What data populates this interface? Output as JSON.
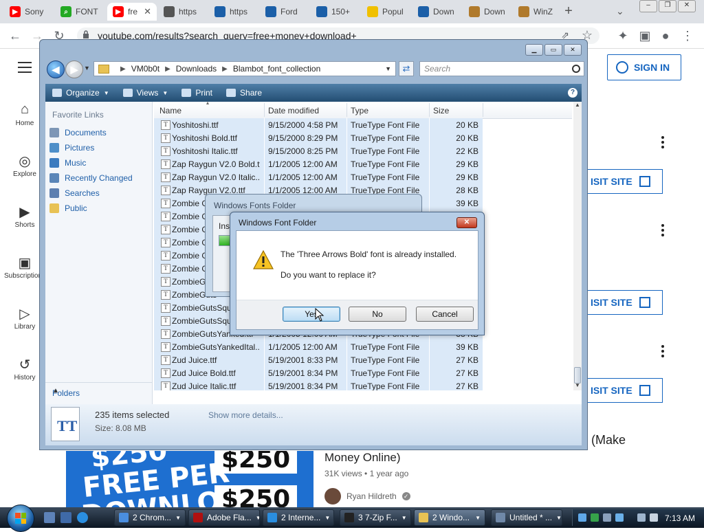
{
  "chrome": {
    "tabs": [
      {
        "label": "Sony",
        "icon": "youtube-icon",
        "color": "#ff0000"
      },
      {
        "label": "FONT",
        "icon": "search-icon",
        "color": "#23a923"
      },
      {
        "label": "fre",
        "icon": "youtube-icon",
        "color": "#ff0000",
        "active": true
      },
      {
        "label": "https",
        "icon": "globe-icon",
        "color": "#555555"
      },
      {
        "label": "https",
        "icon": "zip-icon",
        "color": "#1b5fa8"
      },
      {
        "label": "Ford",
        "icon": "zip-icon",
        "color": "#1b5fa8"
      },
      {
        "label": "150+",
        "icon": "zip-icon",
        "color": "#1b5fa8"
      },
      {
        "label": "Popul",
        "icon": "face-icon",
        "color": "#f0c000"
      },
      {
        "label": "Down",
        "icon": "zip-icon",
        "color": "#1b5fa8"
      },
      {
        "label": "Down",
        "icon": "winzip-icon",
        "color": "#b07a2c"
      },
      {
        "label": "WinZ",
        "icon": "winzip-icon",
        "color": "#b07a2c"
      }
    ],
    "tab_close": "✕",
    "new_tab": "+",
    "url": "youtube.com/results?search_query=free+money+download+"
  },
  "youtube": {
    "sign_in": "SIGN IN",
    "nav": [
      "Home",
      "Explore",
      "Shorts",
      "Subscriptions",
      "Library",
      "History"
    ],
    "visit_site": "ISIT SITE",
    "make_fragment": "(Make",
    "video_title": "Money Online)",
    "views": "31K views",
    "age": "1 year ago",
    "channel": "Ryan Hildreth",
    "thumb": {
      "line1": "$250",
      "line2": "FREE PER",
      "line3": "DOWNLOAD",
      "price1": "$250",
      "price2": "$250"
    }
  },
  "explorer": {
    "path": [
      "VM0b0t",
      "Downloads",
      "Blambot_font_collection"
    ],
    "search_placeholder": "Search",
    "commands": [
      "Organize",
      "Views",
      "Print",
      "Share"
    ],
    "favorite_links_header": "Favorite Links",
    "favorites": [
      "Documents",
      "Pictures",
      "Music",
      "Recently Changed",
      "Searches",
      "Public"
    ],
    "folders_label": "Folders",
    "columns": [
      "Name",
      "Date modified",
      "Type",
      "Size"
    ],
    "files": [
      {
        "name": "Yoshitoshi.ttf",
        "date": "9/15/2000 4:58 PM",
        "type": "TrueType Font File",
        "size": "20 KB"
      },
      {
        "name": "Yoshitoshi Bold.ttf",
        "date": "9/15/2000 8:29 PM",
        "type": "TrueType Font File",
        "size": "20 KB"
      },
      {
        "name": "Yoshitoshi Italic.ttf",
        "date": "9/15/2000 8:25 PM",
        "type": "TrueType Font File",
        "size": "22 KB"
      },
      {
        "name": "Zap Raygun V2.0 Bold.ttf",
        "date": "1/1/2005 12:00 AM",
        "type": "TrueType Font File",
        "size": "29 KB"
      },
      {
        "name": "Zap Raygun V2.0 Italic....",
        "date": "1/1/2005 12:00 AM",
        "type": "TrueType Font File",
        "size": "29 KB"
      },
      {
        "name": "Zap Raygun V2.0.ttf",
        "date": "1/1/2005 12:00 AM",
        "type": "TrueType Font File",
        "size": "28 KB"
      },
      {
        "name": "Zombie Guts",
        "date": "",
        "type": "",
        "size": "39 KB"
      },
      {
        "name": "Zombie Guts",
        "date": "",
        "type": "",
        "size": ""
      },
      {
        "name": "Zombie Guts",
        "date": "",
        "type": "",
        "size": ""
      },
      {
        "name": "Zombie Guts",
        "date": "",
        "type": "",
        "size": ""
      },
      {
        "name": "Zombie Guts",
        "date": "",
        "type": "",
        "size": ""
      },
      {
        "name": "Zombie Guts",
        "date": "",
        "type": "",
        "size": ""
      },
      {
        "name": "ZombieGuts",
        "date": "",
        "type": "",
        "size": ""
      },
      {
        "name": "ZombieGuts",
        "date": "",
        "type": "",
        "size": ""
      },
      {
        "name": "ZombieGutsSqu",
        "date": "",
        "type": "",
        "size": ""
      },
      {
        "name": "ZombieGutsSqu",
        "date": "",
        "type": "",
        "size": ""
      },
      {
        "name": "ZombieGutsYanked.ttf",
        "date": "1/1/2005 12:00 AM",
        "type": "TrueType Font File",
        "size": "38 KB"
      },
      {
        "name": "ZombieGutsYankedItal...",
        "date": "1/1/2005 12:00 AM",
        "type": "TrueType Font File",
        "size": "39 KB"
      },
      {
        "name": "Zud Juice.ttf",
        "date": "5/19/2001 8:33 PM",
        "type": "TrueType Font File",
        "size": "27 KB"
      },
      {
        "name": "Zud Juice Bold.ttf",
        "date": "5/19/2001 8:34 PM",
        "type": "TrueType Font File",
        "size": "27 KB"
      },
      {
        "name": "Zud Juice Italic.ttf",
        "date": "5/19/2001 8:34 PM",
        "type": "TrueType Font File",
        "size": "27 KB"
      }
    ],
    "details": {
      "count": "235 items selected",
      "size_label": "Size:",
      "size": "8.08 MB",
      "more": "Show more details..."
    }
  },
  "fonts_folder": {
    "title": "Windows Fonts Folder",
    "label": "Inst",
    "progress": 0.07
  },
  "dialog": {
    "title": "Windows Font Folder",
    "message": "The 'Three Arrows Bold' font is already installed.",
    "question": "Do you want to replace it?",
    "yes": "Yes",
    "no": "No",
    "cancel": "Cancel"
  },
  "taskbar": {
    "buttons": [
      {
        "label": "2 Chrom...",
        "icon": "chrome-icon",
        "color": "#4a8ee0"
      },
      {
        "label": "Adobe Fla...",
        "icon": "flash-icon",
        "color": "#b01010"
      },
      {
        "label": "2 Interne...",
        "icon": "ie-icon",
        "color": "#2a8ee0"
      },
      {
        "label": "3 7-Zip F...",
        "icon": "7zip-icon",
        "color": "#222222"
      },
      {
        "label": "2 Windo...",
        "icon": "folder-icon",
        "color": "#e8c254"
      },
      {
        "label": "Untitled * ...",
        "icon": "window-icon",
        "color": "#6f88a8"
      }
    ],
    "clock": "7:13 AM"
  }
}
